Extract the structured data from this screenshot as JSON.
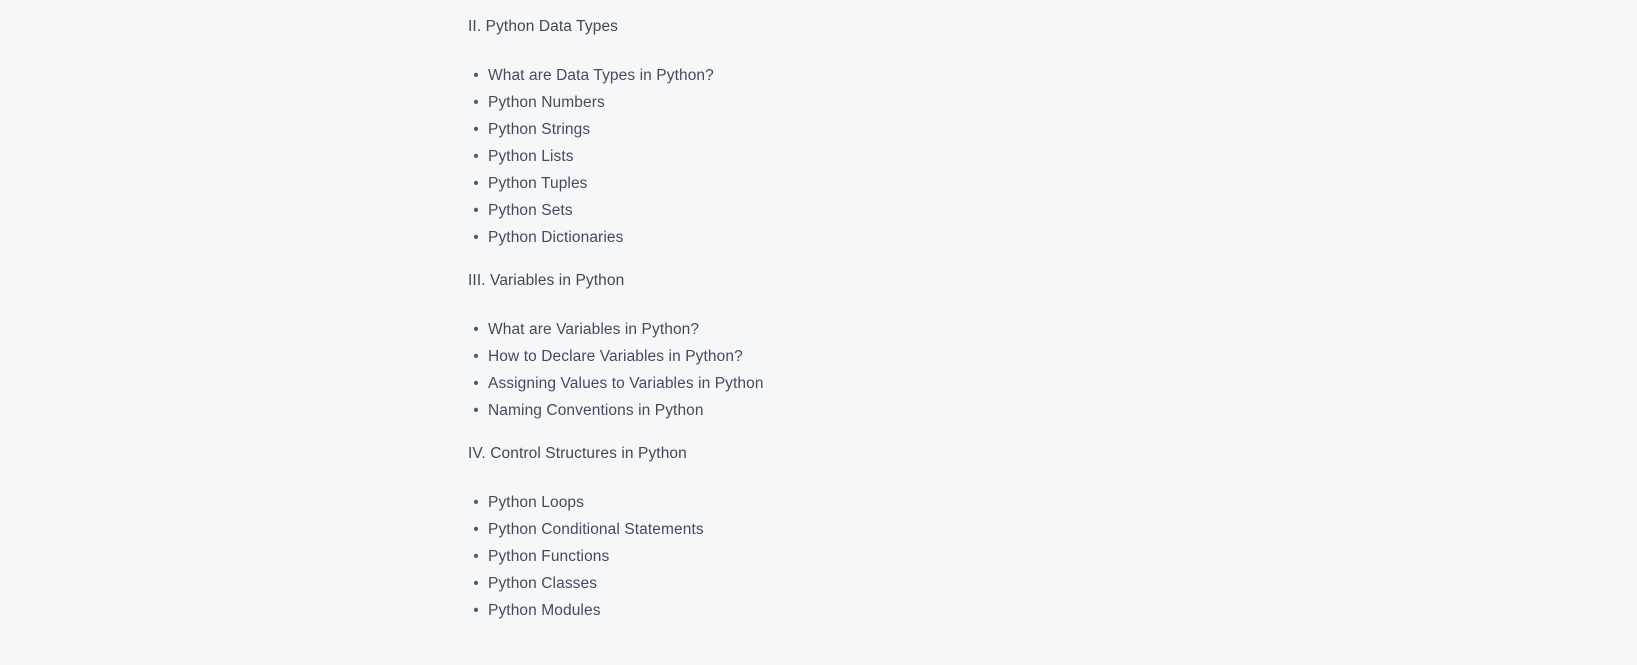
{
  "page": {
    "background_color": "#f6f7f9",
    "text_color": "#3f4857",
    "bullet_color": "#525a6b",
    "bullet_glyph": "•"
  },
  "outline": {
    "sections": [
      {
        "heading": "II. Python Data Types",
        "items": [
          "What are Data Types in Python?",
          "Python Numbers",
          "Python Strings",
          "Python Lists",
          "Python Tuples",
          "Python Sets",
          "Python Dictionaries"
        ]
      },
      {
        "heading": "III. Variables in Python",
        "items": [
          "What are Variables in Python?",
          "How to Declare Variables in Python?",
          "Assigning Values to Variables in Python",
          "Naming Conventions in Python"
        ]
      },
      {
        "heading": "IV. Control Structures in Python",
        "items": [
          "Python Loops",
          "Python Conditional Statements",
          "Python Functions",
          "Python Classes",
          "Python Modules"
        ]
      }
    ]
  }
}
